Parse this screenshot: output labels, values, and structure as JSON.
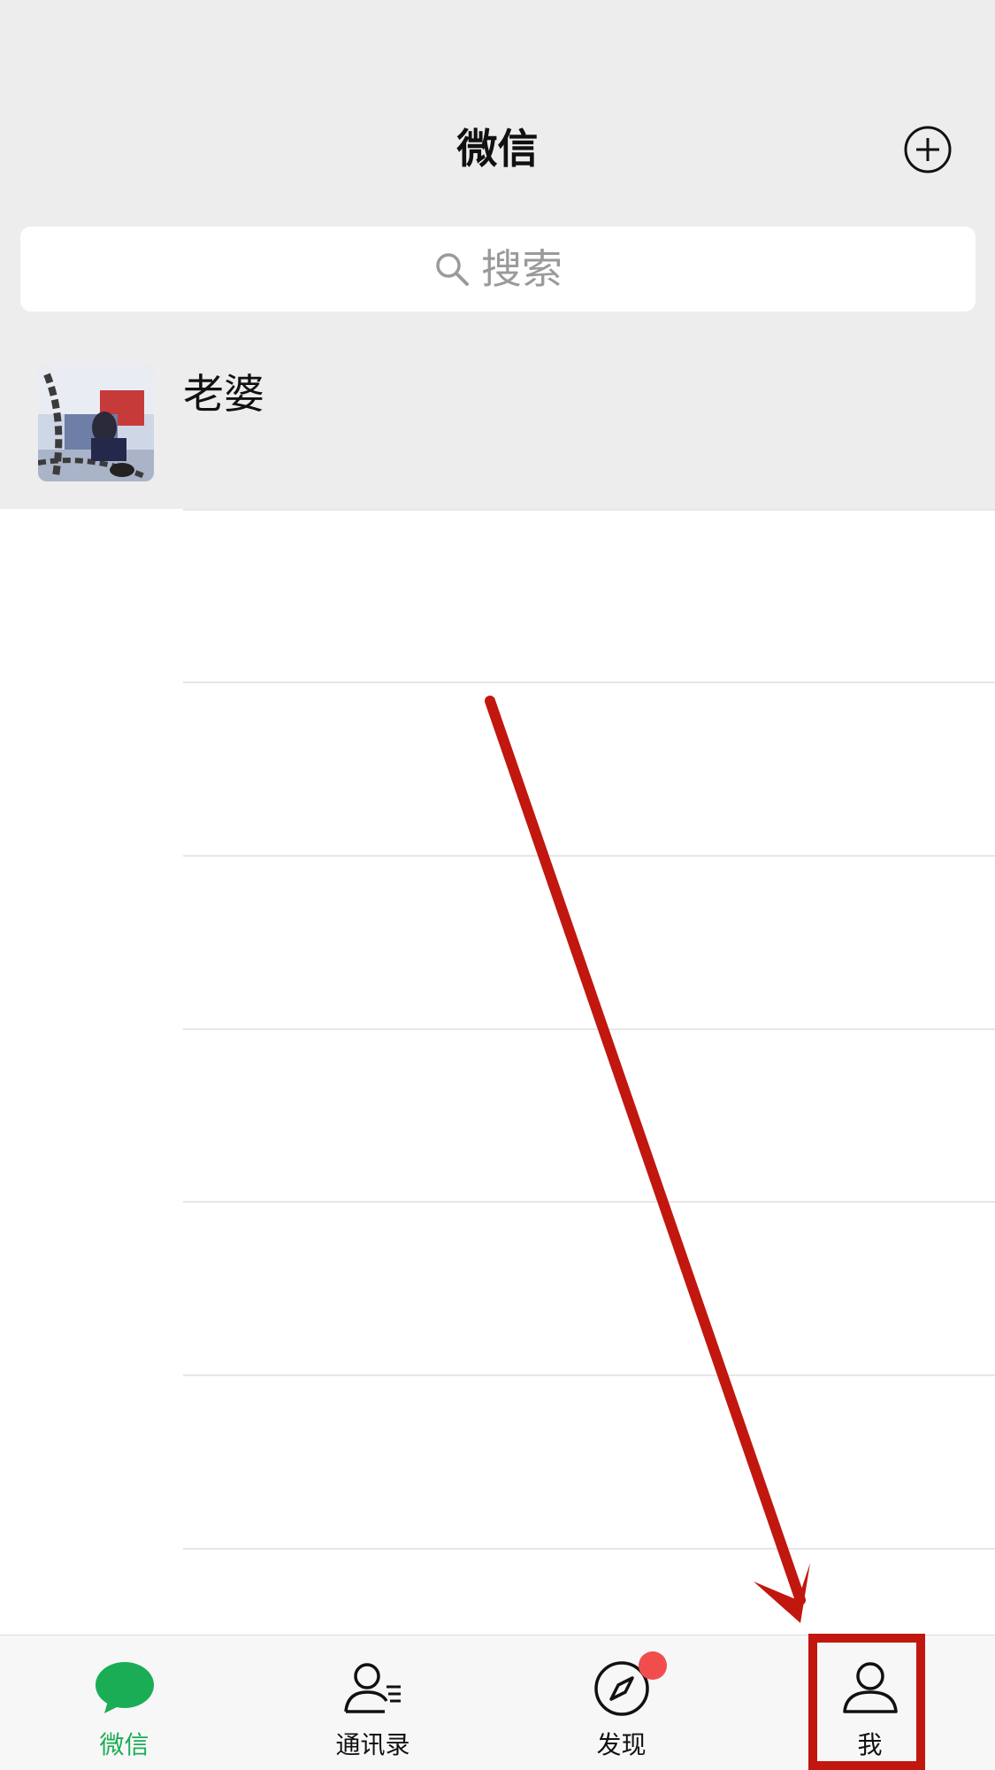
{
  "header": {
    "title": "微信",
    "plus_icon": "plus-circle-icon"
  },
  "search": {
    "placeholder": "搜索",
    "icon": "search-icon"
  },
  "chats": [
    {
      "name": "老婆",
      "avatar": "photo-avatar"
    }
  ],
  "tabbar": {
    "tabs": [
      {
        "label": "微信",
        "icon": "chat-bubble-icon",
        "active": true
      },
      {
        "label": "通讯录",
        "icon": "contacts-icon",
        "active": false
      },
      {
        "label": "发现",
        "icon": "compass-icon",
        "active": false,
        "badge": "dot"
      },
      {
        "label": "我",
        "icon": "person-icon",
        "active": false
      }
    ]
  },
  "annotation": {
    "arrow_color": "#c1170f",
    "target": "我"
  },
  "colors": {
    "header_bg": "#ededed",
    "accent_green": "#1aad56",
    "badge_red": "#f24d4d",
    "annotation_red": "#c1170f"
  }
}
